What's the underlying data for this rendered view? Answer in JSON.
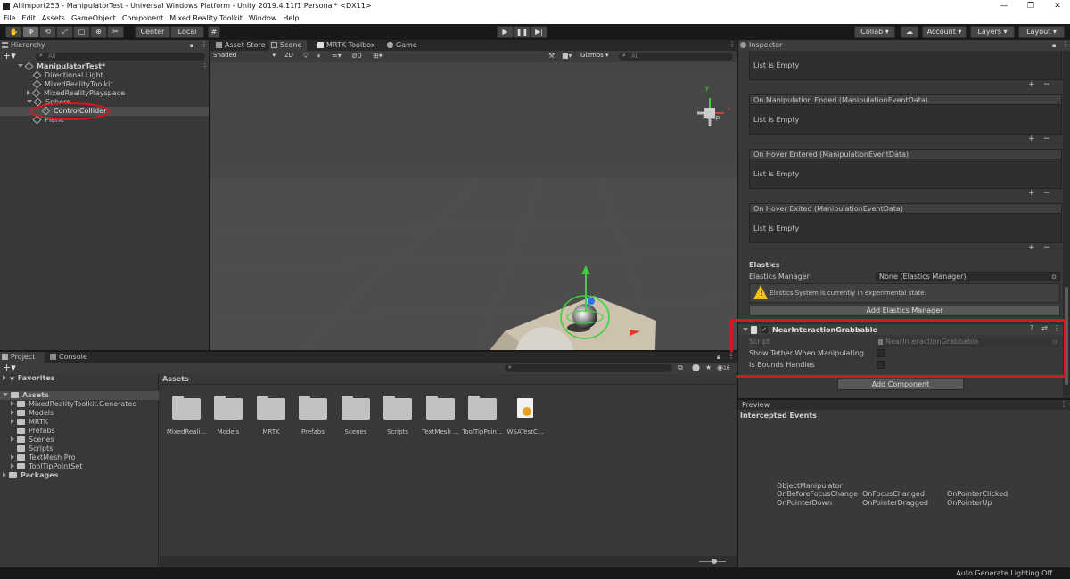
{
  "window": {
    "title": "AllImport253 - ManipulatorTest - Universal Windows Platform - Unity 2019.4.11f1 Personal* <DX11>",
    "minimize": "—",
    "maximize": "❐",
    "close": "✕"
  },
  "menu": [
    "File",
    "Edit",
    "Assets",
    "GameObject",
    "Component",
    "Mixed Reality Toolkit",
    "Window",
    "Help"
  ],
  "toolbar": {
    "pivot_label": "Center",
    "space_label": "Local",
    "collab_label": "Collab ▾",
    "account_label": "Account",
    "layers_label": "Layers",
    "layout_label": "Layout"
  },
  "hierarchy": {
    "tab_label": "Hierarchy",
    "search_placeholder": "All",
    "scene_name": "ManipulatorTest*",
    "items": [
      "Directional Light",
      "MixedRealityToolkit",
      "MixedRealityPlayspace",
      "Sphere",
      "ControlCollider",
      "Plane"
    ]
  },
  "scene_view": {
    "tabs": [
      "Asset Store",
      "Scene",
      "MRTK Toolbox",
      "Game"
    ],
    "shading_mode": "Shaded",
    "mode_2d": "2D",
    "effects_count": "0",
    "gizmos_label": "Gizmos",
    "search_placeholder": "All",
    "axis_y": "y",
    "axis_x": "x",
    "projection": "Persp"
  },
  "inspector": {
    "tab_label": "Inspector",
    "list_empty": "List is Empty",
    "events": [
      "On Manipulation Ended (ManipulationEventData)",
      "On Hover Entered (ManipulationEventData)",
      "On Hover Exited (ManipulationEventData)"
    ],
    "elastics_header": "Elastics",
    "elastics_manager_label": "Elastics Manager",
    "elastics_manager_value": "None (Elastics Manager)",
    "elastics_warning": "Elastics System is currently in experimental state.",
    "add_elastics_button": "Add Elastics Manager",
    "component_name": "NearInteractionGrabbable",
    "script_label": "Script",
    "script_value": "NearInteractionGrabbable",
    "show_tether_label": "Show Tether When Manipulating",
    "bounds_handles_label": "Is Bounds Handles",
    "add_component_button": "Add Component"
  },
  "preview": {
    "tab_label": "Preview",
    "intercepted_events": "Intercepted Events",
    "object_name": "ObjectManipulator",
    "events": [
      "OnBeforeFocusChange",
      "OnFocusChanged",
      "OnPointerClicked",
      "OnPointerDown",
      "OnPointerDragged",
      "OnPointerUp"
    ]
  },
  "project": {
    "tabs": [
      "Project",
      "Console"
    ],
    "favorites": "Favorites",
    "assets_root": "Assets",
    "folders": [
      "MixedRealityToolkit.Generated",
      "Models",
      "MRTK",
      "Prefabs",
      "Scenes",
      "Scripts",
      "TextMesh Pro",
      "ToolTipPointSet"
    ],
    "packages": "Packages",
    "breadcrumb": "Assets",
    "grid_items": [
      "MixedReali...",
      "Models",
      "MRTK",
      "Prefabs",
      "Scenes",
      "Scripts",
      "TextMesh ...",
      "ToolTipPoin...",
      "WSATestC..."
    ],
    "badge_count": "16"
  },
  "status_bar": "Auto Generate Lighting Off",
  "colors": {
    "highlight_red": "#e0141e",
    "gizmo_green": "#3ad43a",
    "gizmo_red": "#e23a2a",
    "gizmo_blue": "#3a6ce2"
  }
}
